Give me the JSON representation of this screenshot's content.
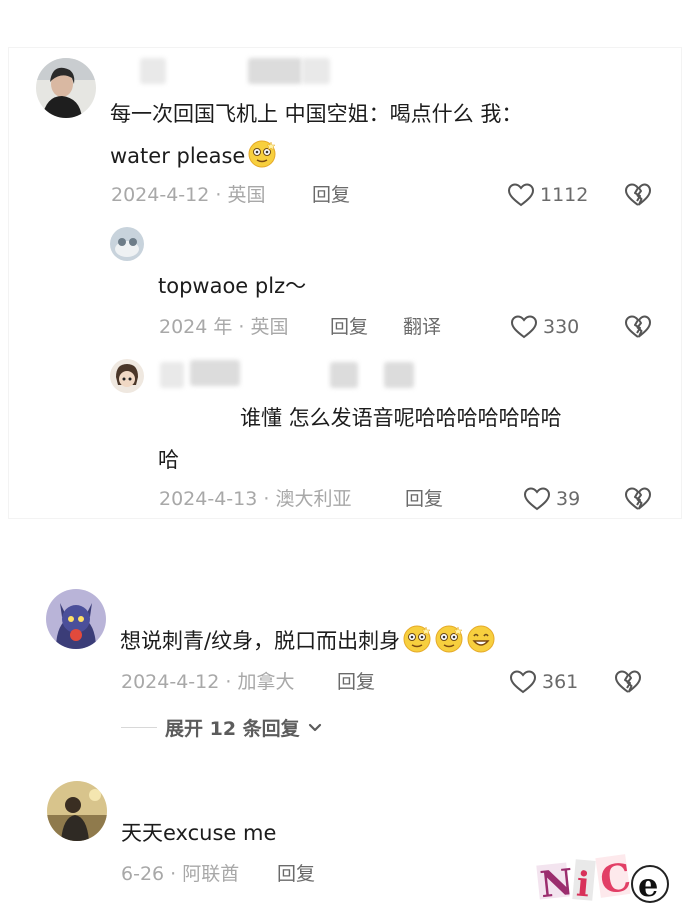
{
  "comments": [
    {
      "text_line1": "每一次回国飞机上 中国空姐：喝点什么 我：",
      "text_line2": "water please",
      "date_region": "2024-4-12 · 英国",
      "reply": "回复",
      "likes": "1112"
    },
    {
      "text": "topwaoe plz～",
      "date_region": "2024 年 · 英国",
      "reply": "回复",
      "translate": "翻译",
      "likes": "330"
    },
    {
      "text_line1": "谁懂 怎么发语音呢哈哈哈哈哈哈哈",
      "text_line2": "哈",
      "date_region": "2024-4-13 · 澳大利亚",
      "reply": "回复",
      "likes": "39"
    },
    {
      "text": "想说刺青/纹身，脱口而出刺身",
      "date_region": "2024-4-12 · 加拿大",
      "reply": "回复",
      "likes": "361"
    },
    {
      "text": "天天excuse me",
      "date_region": "6-26 · 阿联酋",
      "reply": "回复"
    }
  ],
  "expand_label": "展开 12 条回复",
  "watermark": "NiCe",
  "colors": {
    "meta": "#a8a8a8",
    "text": "#1c1c1c",
    "action": "#6a6a6a"
  }
}
